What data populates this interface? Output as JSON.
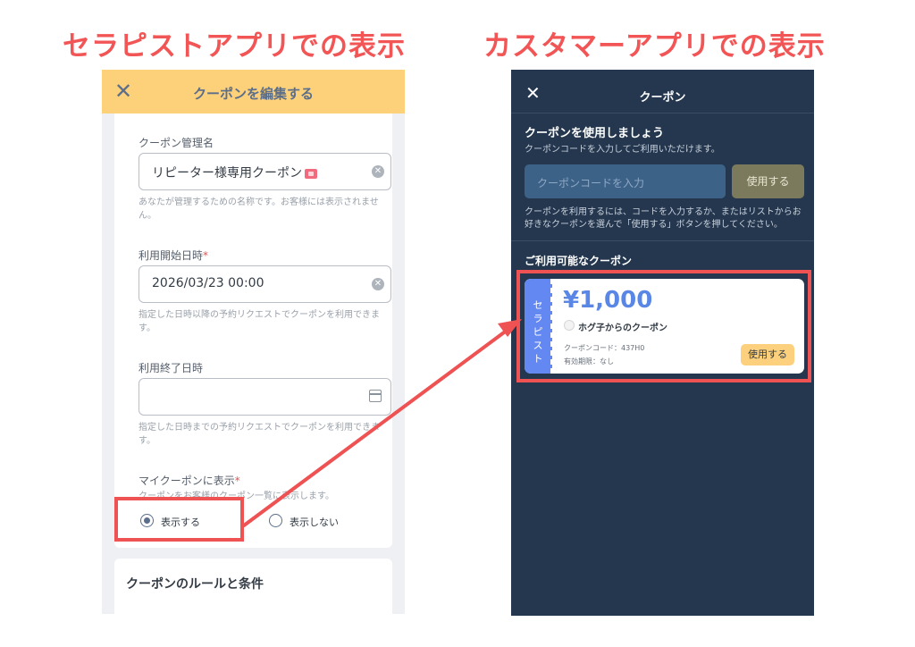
{
  "headings": {
    "therapist": "セラピストアプリでの表示",
    "customer": "カスタマーアプリでの表示"
  },
  "therapist_app": {
    "header": {
      "close_icon": "✕",
      "title": "クーポンを編集する"
    },
    "fields": {
      "name": {
        "label": "クーポン管理名",
        "value": "リピーター様専用クーポン",
        "help": "あなたが管理するための名称です。お客様には表示されません。"
      },
      "start": {
        "label": "利用開始日時",
        "required_mark": "*",
        "value": "2026/03/23 00:00",
        "help": "指定した日時以降の予約リクエストでクーポンを利用できます。"
      },
      "end": {
        "label": "利用終了日時",
        "value": "",
        "help": "指定した日時までの予約リクエストでクーポンを利用できます。"
      },
      "my_coupon": {
        "label": "マイクーポンに表示",
        "required_mark": "*",
        "help": "クーポンをお客様のクーポン一覧に表示します。",
        "options": [
          "表示する",
          "表示しない"
        ],
        "selected": "表示する"
      }
    },
    "rules_section": {
      "title": "クーポンのルールと条件"
    }
  },
  "customer_app": {
    "header": {
      "close_icon": "✕",
      "title": "クーポン"
    },
    "use_section": {
      "heading": "クーポンを使用しましょう",
      "subtext": "クーポンコードを入力してご利用いただけます。",
      "input_placeholder": "クーポンコードを入力",
      "use_button": "使用する",
      "note": "クーポンを利用するには、コードを入力するか、またはリストからお好きなクーポンを選んで「使用する」ボタンを押してください。"
    },
    "available_heading": "ご利用可能なクーポン",
    "coupon": {
      "stub_label": "セラピスト",
      "amount": "¥1,000",
      "name": "ホグ子からのクーポン",
      "code": "クーポンコード：437H0",
      "expiry": "有効期限：なし",
      "use_button": "使用する"
    }
  },
  "colors": {
    "heading": "#f25555",
    "therapist_header": "#fdd07a",
    "customer_bg": "#24374e",
    "coupon_stub": "#6488f2",
    "highlight": "#ee5253"
  }
}
